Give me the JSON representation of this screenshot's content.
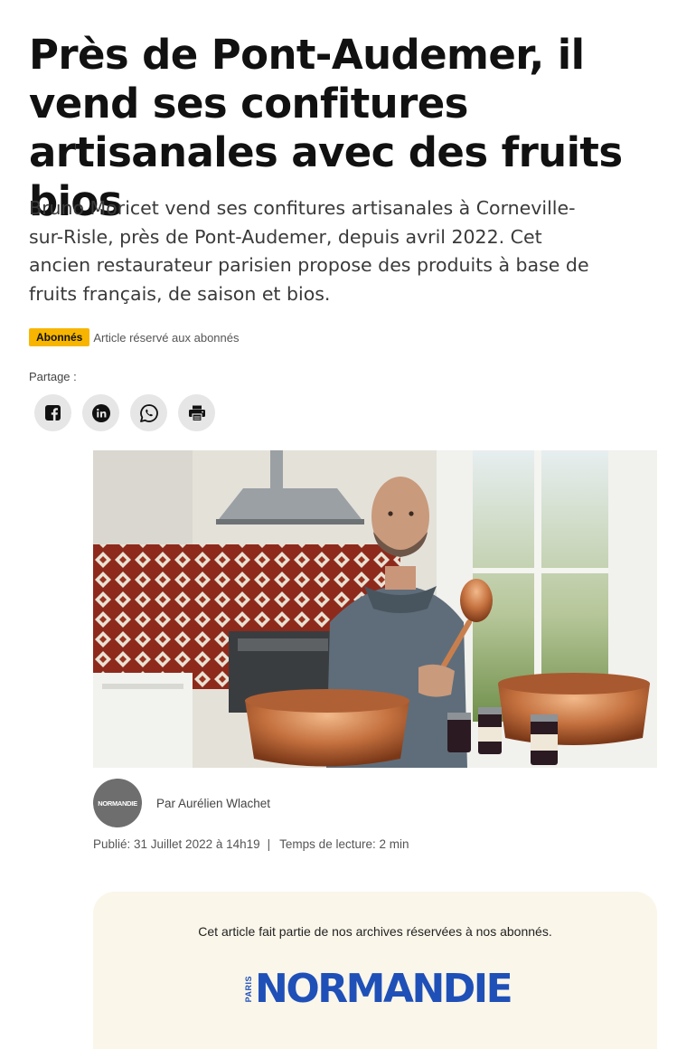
{
  "article": {
    "title": "Près de Pont-Audemer, il vend ses confitures artisanales avec des fruits bios",
    "lead": "Bruno Moricet vend ses confitures artisanales à Corneville-sur-Risle, près de Pont-Audemer, depuis avril 2022. Cet ancien restaurateur parisien propose des produits à base de fruits français, de saison et bios.",
    "badge": "Abonnés",
    "badge_note": "Article réservé aux abonnés"
  },
  "share": {
    "label": "Partage :",
    "buttons": [
      {
        "icon": "facebook-icon"
      },
      {
        "icon": "linkedin-icon"
      },
      {
        "icon": "whatsapp-icon"
      },
      {
        "icon": "print-icon"
      }
    ]
  },
  "author": {
    "avatar_text": "NORMANDIE",
    "byline": "Par Aurélien Wlachet"
  },
  "meta": {
    "published": "Publié: 31 Juillet 2022 à 14h19",
    "separator": "|",
    "reading_time": "Temps de lecture: 2 min"
  },
  "paywall": {
    "text": "Cet article fait partie de nos archives réservées à nos abonnés.",
    "brand_small": "PARIS",
    "brand_name": "NORMANDIE"
  },
  "colors": {
    "badge": "#f7b500",
    "brand_blue": "#1f50b8",
    "paywall_bg": "#faf6ea"
  }
}
